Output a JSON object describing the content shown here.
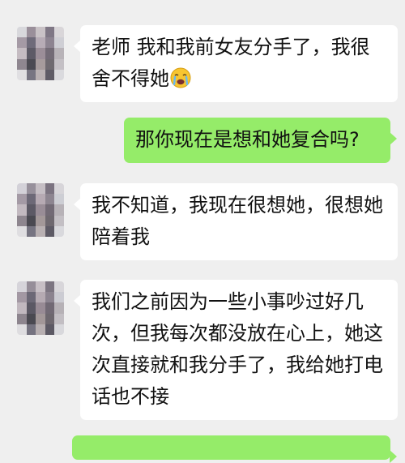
{
  "chat": {
    "messages": [
      {
        "sender": "other",
        "text": "老师 我和我前女友分手了，我很舍不得她",
        "emoji": "crying-face-icon"
      },
      {
        "sender": "self",
        "text": "那你现在是想和她复合吗?"
      },
      {
        "sender": "other",
        "text": "我不知道，我现在很想她，很想她陪着我"
      },
      {
        "sender": "other",
        "text": "我们之前因为一些小事吵过好几次，但我每次都没放在心上，她这次直接就和我分手了，我给她打电话也不接"
      },
      {
        "sender": "self",
        "text": ""
      }
    ]
  },
  "colors": {
    "background": "#efefef",
    "incoming_bubble": "#ffffff",
    "outgoing_bubble": "#95ec69",
    "text": "#111111"
  }
}
